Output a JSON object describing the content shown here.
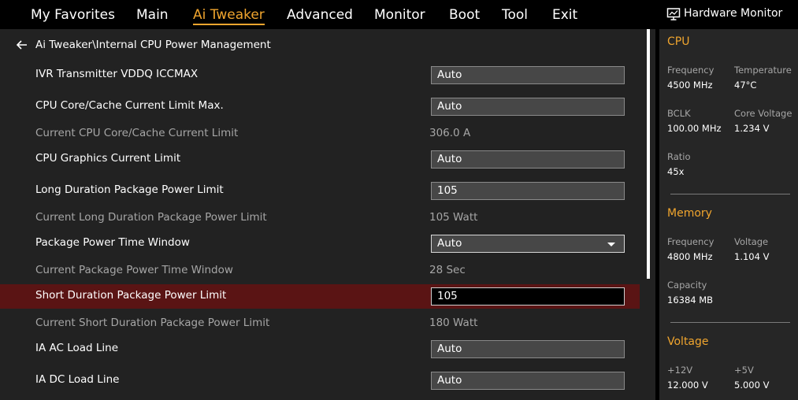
{
  "menu": [
    "My Favorites",
    "Main",
    "Ai Tweaker",
    "Advanced",
    "Monitor",
    "Boot",
    "Tool",
    "Exit"
  ],
  "active_menu": "Ai Tweaker",
  "breadcrumb": "Ai Tweaker\\Internal CPU Power Management",
  "rows": [
    {
      "label": "IVR Transmitter VDDQ ICCMAX",
      "value": "Auto"
    },
    {
      "label": "CPU Core/Cache Current Limit Max.",
      "value": "Auto"
    },
    {
      "label": "Current CPU Core/Cache Current Limit",
      "value": "306.0 A"
    },
    {
      "label": "CPU Graphics Current Limit",
      "value": "Auto"
    },
    {
      "label": "Long Duration Package Power Limit",
      "value": "105"
    },
    {
      "label": "Current Long Duration Package Power Limit",
      "value": "105 Watt"
    },
    {
      "label": "Package Power Time Window",
      "value": "Auto"
    },
    {
      "label": "Current Package Power Time Window",
      "value": "28 Sec"
    },
    {
      "label": "Short Duration Package Power Limit",
      "value": "105"
    },
    {
      "label": "Current Short Duration Package Power Limit",
      "value": "180 Watt"
    },
    {
      "label": "IA AC Load Line",
      "value": "Auto"
    },
    {
      "label": "IA DC Load Line",
      "value": "Auto"
    }
  ],
  "hardware_monitor": {
    "title": "Hardware Monitor",
    "cpu": {
      "title": "CPU",
      "frequency_label": "Frequency",
      "frequency": "4500 MHz",
      "temperature_label": "Temperature",
      "temperature": "47°C",
      "bclk_label": "BCLK",
      "bclk": "100.00 MHz",
      "core_voltage_label": "Core Voltage",
      "core_voltage": "1.234 V",
      "ratio_label": "Ratio",
      "ratio": "45x"
    },
    "memory": {
      "title": "Memory",
      "frequency_label": "Frequency",
      "frequency": "4800 MHz",
      "voltage_label": "Voltage",
      "voltage": "1.104 V",
      "capacity_label": "Capacity",
      "capacity": "16384 MB"
    },
    "voltage": {
      "title": "Voltage",
      "v12_label": "+12V",
      "v12": "12.000 V",
      "v5_label": "+5V",
      "v5": "5.000 V"
    }
  },
  "colors": {
    "accent": "#f0a52e",
    "highlight_row": "#5a1414",
    "panel": "#222222"
  },
  "icons": {
    "back": "arrow-left-icon",
    "monitor": "monitor-icon",
    "dropdown": "chevron-down-icon"
  }
}
